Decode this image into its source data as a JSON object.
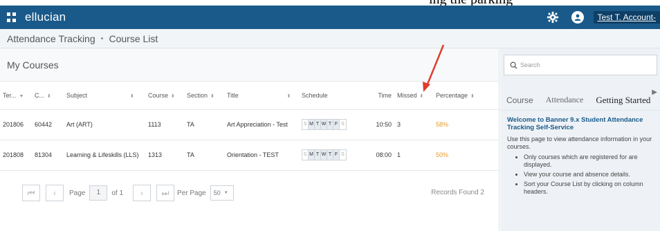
{
  "caption": "ing the parking",
  "header": {
    "brand": "ellucian",
    "user_name": "Test T. Account-"
  },
  "breadcrumb": {
    "app": "Attendance Tracking",
    "separator": "•",
    "page": "Course List"
  },
  "main": {
    "title": "My Courses",
    "columns": [
      "Ter...",
      "C...",
      "Subject",
      "Course",
      "Section",
      "Title",
      "Schedule",
      "Time",
      "Missed",
      "Percentage"
    ],
    "days": [
      "S",
      "M",
      "T",
      "W",
      "T",
      "F",
      "S"
    ],
    "rows": [
      {
        "term": "201806",
        "crn": "60442",
        "subject": "Art (ART)",
        "course": "1113",
        "section": "TA",
        "title": "Art Appreciation - Test",
        "time": "10:50",
        "missed": "3",
        "percentage": "58%"
      },
      {
        "term": "201808",
        "crn": "81304",
        "subject": "Learning & Lifeskills (LLS)",
        "course": "1313",
        "section": "TA",
        "title": "Orientation - TEST",
        "time": "08:00",
        "missed": "1",
        "percentage": "50%"
      }
    ]
  },
  "pager": {
    "page_label": "Page",
    "page_value": "1",
    "of_label": "of 1",
    "per_page_label": "Per Page",
    "per_page_value": "50",
    "records": "Records Found 2"
  },
  "side": {
    "search_placeholder": "Search",
    "tabs": [
      "Course",
      "Attendance",
      "Getting Started"
    ],
    "welcome_title": "Welcome to Banner 9.x Student Attendance Tracking Self-Service",
    "intro": "Use this page to view attendance information in your courses.",
    "bullets": [
      "Only courses which are registered for are displayed.",
      "View your course and absence details.",
      "Sort your Course List by clicking on column headers."
    ]
  },
  "colors": {
    "header": "#1a5a8a",
    "accent_link": "#1a5a8a",
    "percentage": "#e89a2a",
    "annotation_arrow": "#e03c2c"
  }
}
